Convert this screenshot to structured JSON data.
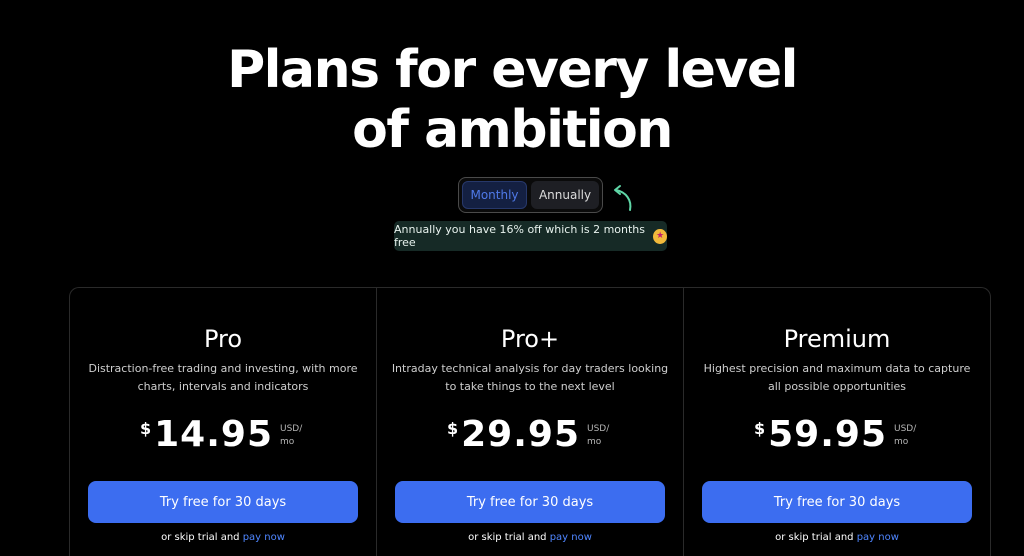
{
  "header": {
    "title_line1": "Plans for every level",
    "title_line2": "of ambition"
  },
  "billing_toggle": {
    "options": [
      "Monthly",
      "Annually"
    ],
    "selected": "Monthly"
  },
  "savings_note": {
    "text": "Annually you have 16% off which is 2 months free",
    "emoji": "star-struck-emoji"
  },
  "plans": [
    {
      "name": "Pro",
      "description": "Distraction-free trading and investing, with more charts, intervals and indicators",
      "currency": "$",
      "price": "14.95",
      "unit_line1": "USD/",
      "unit_line2": "mo",
      "cta": "Try free for 30 days",
      "skip_text": "or skip trial and",
      "pay_link": "pay now"
    },
    {
      "name": "Pro+",
      "description": "Intraday technical analysis for day traders looking to take things to the next level",
      "currency": "$",
      "price": "29.95",
      "unit_line1": "USD/",
      "unit_line2": "mo",
      "cta": "Try free for 30 days",
      "skip_text": "or skip trial and",
      "pay_link": "pay now"
    },
    {
      "name": "Premium",
      "description": "Highest precision and maximum data to capture all possible opportunities",
      "currency": "$",
      "price": "59.95",
      "unit_line1": "USD/",
      "unit_line2": "mo",
      "cta": "Try free for 30 days",
      "skip_text": "or skip trial and",
      "pay_link": "pay now"
    }
  ],
  "colors": {
    "background": "#000000",
    "cta_blue": "#3c6df0",
    "link_blue": "#4f86ff",
    "toggle_selected_text": "#4f79e8",
    "savings_bg": "#162a26",
    "arrow_green": "#5fd6a6"
  }
}
